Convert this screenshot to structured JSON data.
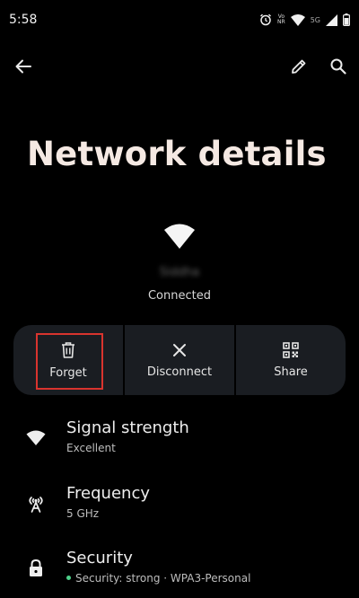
{
  "status_bar": {
    "time": "5:58",
    "network_label_top": "Vo",
    "network_label_bottom": "NR",
    "net_type": "5G"
  },
  "appbar": {
    "back_icon": "arrow-back-icon",
    "edit_icon": "pencil-icon",
    "search_icon": "search-icon"
  },
  "page": {
    "title": "Network details"
  },
  "network": {
    "name": "Siddha",
    "status": "Connected"
  },
  "actions": [
    {
      "label": "Forget",
      "icon": "trash-icon"
    },
    {
      "label": "Disconnect",
      "icon": "close-icon"
    },
    {
      "label": "Share",
      "icon": "qr-code-icon"
    }
  ],
  "details": [
    {
      "title": "Signal strength",
      "value": "Excellent",
      "icon": "wifi-icon"
    },
    {
      "title": "Frequency",
      "value": "5 GHz",
      "icon": "antenna-icon"
    },
    {
      "title": "Security",
      "value": "Security: strong · WPA3-Personal",
      "icon": "lock-icon"
    }
  ],
  "colors": {
    "background": "#000000",
    "title": "#f5e9e3",
    "action_bar": "#1a1d22",
    "highlight": "#d9342e",
    "secure_bullet": "#4ed18a"
  }
}
